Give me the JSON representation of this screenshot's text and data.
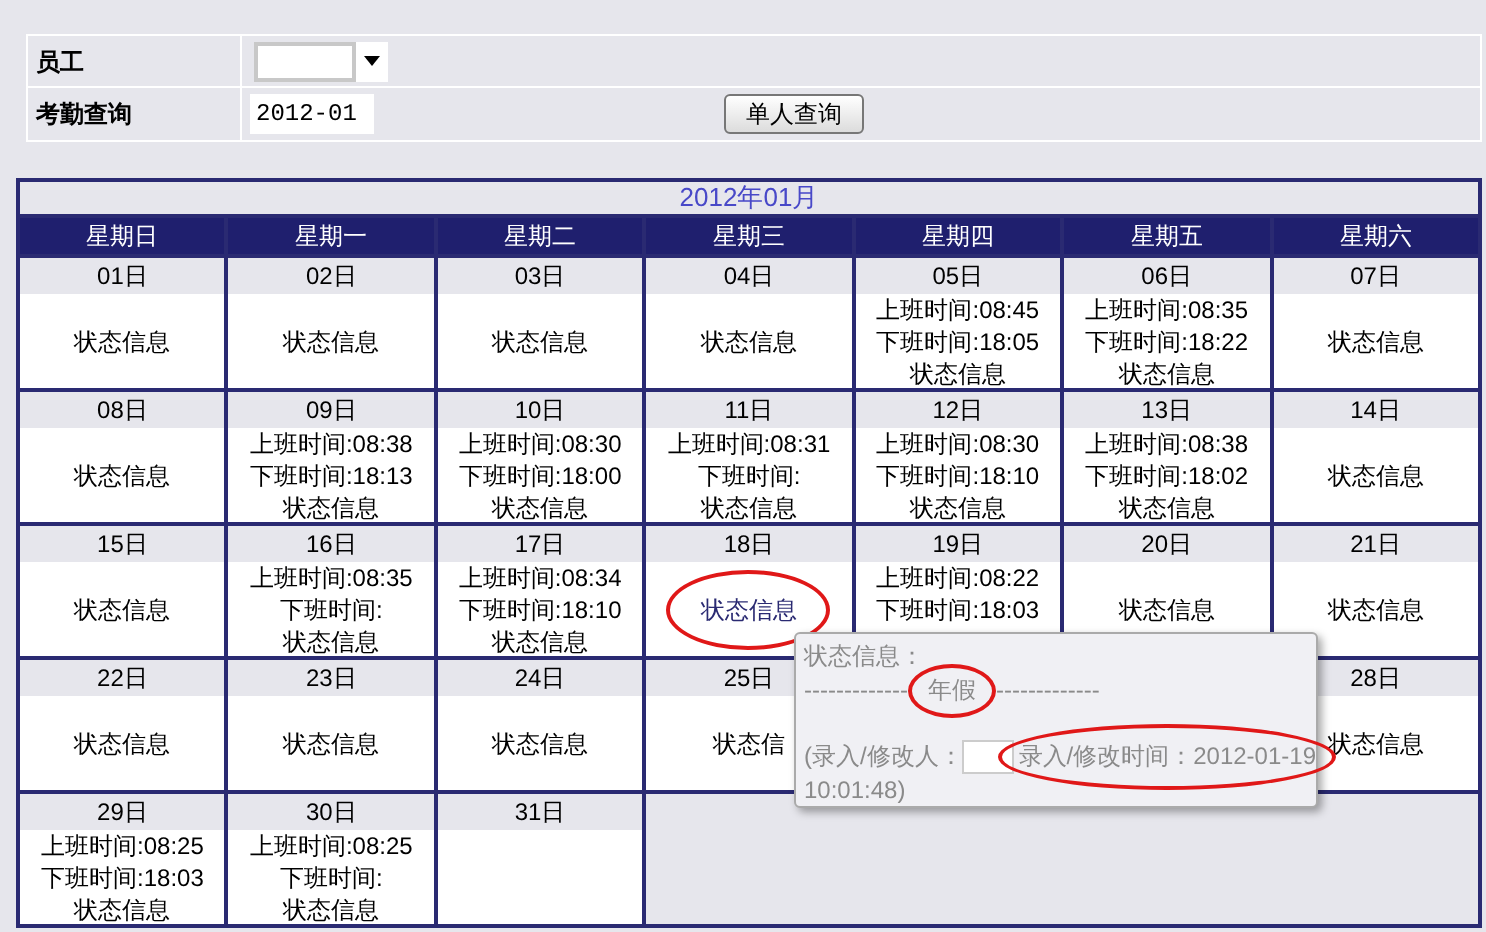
{
  "employee": {
    "label": "员工"
  },
  "query": {
    "label": "考勤查询",
    "value": "2012-01",
    "button": "单人查询"
  },
  "calendar": {
    "title": "2012年01月",
    "weekdays": [
      "星期日",
      "星期一",
      "星期二",
      "星期三",
      "星期四",
      "星期五",
      "星期六"
    ],
    "weeks": [
      [
        {
          "kind": "day",
          "label": "01日",
          "status": "状态信息",
          "circled": false
        },
        {
          "kind": "day",
          "label": "02日",
          "status": "状态信息",
          "circled": false
        },
        {
          "kind": "day",
          "label": "03日",
          "status": "状态信息",
          "circled": false
        },
        {
          "kind": "day",
          "label": "04日",
          "status": "状态信息",
          "circled": false
        },
        {
          "kind": "day",
          "label": "05日",
          "times": [
            "上班时间:08:45",
            "下班时间:18:05"
          ],
          "status": "状态信息",
          "circled": false
        },
        {
          "kind": "day",
          "label": "06日",
          "times": [
            "上班时间:08:35",
            "下班时间:18:22"
          ],
          "status": "状态信息",
          "circled": false
        },
        {
          "kind": "day",
          "label": "07日",
          "status": "状态信息",
          "circled": false
        }
      ],
      [
        {
          "kind": "day",
          "label": "08日",
          "status": "状态信息",
          "circled": false
        },
        {
          "kind": "day",
          "label": "09日",
          "times": [
            "上班时间:08:38",
            "下班时间:18:13"
          ],
          "status": "状态信息",
          "circled": false
        },
        {
          "kind": "day",
          "label": "10日",
          "times": [
            "上班时间:08:30",
            "下班时间:18:00"
          ],
          "status": "状态信息",
          "circled": false
        },
        {
          "kind": "day",
          "label": "11日",
          "times": [
            "上班时间:08:31",
            "下班时间:"
          ],
          "status": "状态信息",
          "circled": false
        },
        {
          "kind": "day",
          "label": "12日",
          "times": [
            "上班时间:08:30",
            "下班时间:18:10"
          ],
          "status": "状态信息",
          "circled": false
        },
        {
          "kind": "day",
          "label": "13日",
          "times": [
            "上班时间:08:38",
            "下班时间:18:02"
          ],
          "status": "状态信息",
          "circled": false
        },
        {
          "kind": "day",
          "label": "14日",
          "status": "状态信息",
          "circled": false
        }
      ],
      [
        {
          "kind": "day",
          "label": "15日",
          "status": "状态信息",
          "circled": false
        },
        {
          "kind": "day",
          "label": "16日",
          "times": [
            "上班时间:08:35",
            "下班时间:"
          ],
          "status": "状态信息",
          "circled": false
        },
        {
          "kind": "day",
          "label": "17日",
          "times": [
            "上班时间:08:34",
            "下班时间:18:10"
          ],
          "status": "状态信息",
          "circled": false
        },
        {
          "kind": "day",
          "label": "18日",
          "status": "状态信息",
          "circled": true
        },
        {
          "kind": "day",
          "label": "19日",
          "times": [
            "上班时间:08:22",
            "下班时间:18:03"
          ]
        },
        {
          "kind": "day",
          "label": "20日",
          "status": "状态信息",
          "circled": false
        },
        {
          "kind": "day",
          "label": "21日",
          "status": "状态信息",
          "circled": false
        }
      ],
      [
        {
          "kind": "day",
          "label": "22日",
          "status": "状态信息",
          "circled": false
        },
        {
          "kind": "day",
          "label": "23日",
          "status": "状态信息",
          "circled": false
        },
        {
          "kind": "day",
          "label": "24日",
          "status": "状态信息",
          "circled": false
        },
        {
          "kind": "day",
          "label": "25日",
          "status": "状态信",
          "circled": false
        },
        {
          "kind": "blank"
        },
        {
          "kind": "blank"
        },
        {
          "kind": "day",
          "label": "28日",
          "status": "状态信息",
          "circled": false
        }
      ],
      [
        {
          "kind": "day",
          "label": "29日",
          "times": [
            "上班时间:08:25",
            "下班时间:18:03"
          ],
          "status": "状态信息",
          "circled": false
        },
        {
          "kind": "day",
          "label": "30日",
          "times": [
            "上班时间:08:25",
            "下班时间:"
          ],
          "status": "状态信息",
          "circled": false
        },
        {
          "kind": "day",
          "label": "31日"
        }
      ]
    ]
  },
  "tooltip": {
    "heading": "状态信息：",
    "divider_left": "-------------",
    "leave_type": "年假",
    "leave_circled": true,
    "divider_right": "-------------",
    "editor_label": "(录入/修改人：",
    "time_text": "录入/修改时间：2012-01-19",
    "time_rest": "10:01:48)",
    "time_circled": true
  }
}
